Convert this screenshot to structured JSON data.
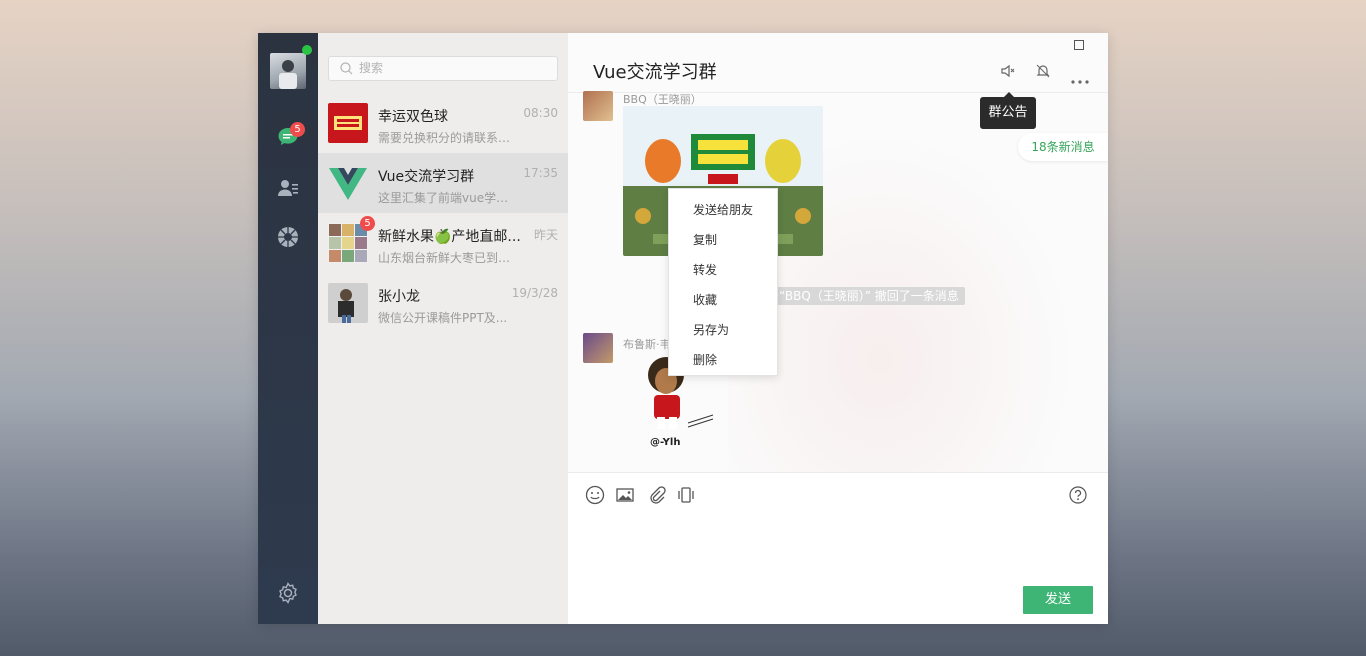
{
  "chat_list": {
    "search_placeholder": "搜索",
    "items": [
      {
        "name": "幸运双色球",
        "time": "08:30",
        "preview": "需要兑换积分的请联系Q..."
      },
      {
        "name": "Vue交流学习群",
        "time": "17:35",
        "preview": "这里汇集了前端vue学习..."
      },
      {
        "name": "新鲜水果🍏产地直邮...",
        "time": "昨天",
        "preview": "山东烟台新鲜大枣已到，欢...",
        "badge": "5"
      },
      {
        "name": "张小龙",
        "time": "19/3/28",
        "preview": "微信公开课稿件PPT及..."
      }
    ]
  },
  "nav": {
    "chat_badge": "5"
  },
  "chat": {
    "title": "Vue交流学习群",
    "tooltip": "群公告",
    "new_messages": "18条新消息",
    "messages": [
      {
        "sender": "BBQ（王晓丽）"
      },
      {
        "recall_text": "“BBQ（王晓丽）” 撤回了一条消息"
      },
      {
        "sender": "布鲁斯·韦恩"
      }
    ],
    "sticker_caption": "@-Ylh",
    "context_menu": [
      "发送给朋友",
      "复制",
      "转发",
      "收藏",
      "另存为",
      "删除"
    ],
    "send_label": "发送"
  },
  "colors": {
    "accent": "#3eb575",
    "badge": "#f14c4c",
    "nav_bg": "#2b3340"
  }
}
